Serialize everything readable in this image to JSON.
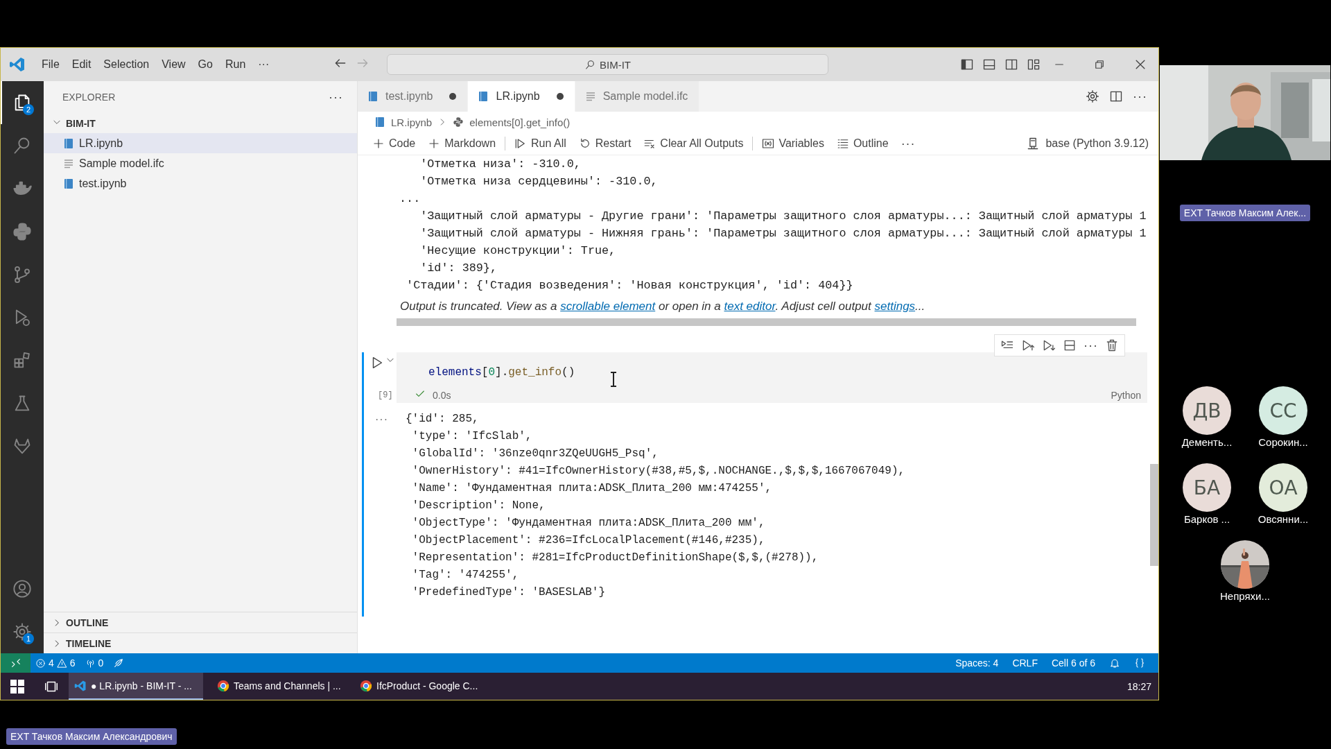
{
  "window": {
    "menu": [
      "File",
      "Edit",
      "Selection",
      "View",
      "Go",
      "Run"
    ],
    "menu_more": "···",
    "command_center": "BIM-IT"
  },
  "activity_bar": {
    "top": [
      {
        "kind": "explorer",
        "selected": true,
        "badge": "2"
      },
      {
        "kind": "search",
        "selected": false
      },
      {
        "kind": "docker",
        "selected": false
      },
      {
        "kind": "python",
        "selected": false
      },
      {
        "kind": "scm",
        "selected": false
      },
      {
        "kind": "debug",
        "selected": false
      },
      {
        "kind": "extensions",
        "selected": false
      },
      {
        "kind": "testing",
        "selected": false
      },
      {
        "kind": "gitlab",
        "selected": false
      }
    ],
    "bottom": [
      {
        "kind": "account",
        "selected": false
      },
      {
        "kind": "settings",
        "selected": false,
        "badge": "1"
      }
    ]
  },
  "sidebar": {
    "title": "EXPLORER",
    "more": "···",
    "folder": {
      "label": "BIM-IT",
      "expanded": true,
      "children": [
        {
          "label": "LR.ipynb",
          "kind": "notebook",
          "selected": true
        },
        {
          "label": "Sample model.ifc",
          "kind": "text",
          "selected": false
        },
        {
          "label": "test.ipynb",
          "kind": "notebook",
          "selected": false
        }
      ]
    },
    "sections": [
      {
        "label": "OUTLINE",
        "expanded": false
      },
      {
        "label": "TIMELINE",
        "expanded": false
      }
    ]
  },
  "tabs": [
    {
      "label": "test.ipynb",
      "kind": "notebook",
      "selected": false,
      "dirty": true
    },
    {
      "label": "LR.ipynb",
      "kind": "notebook",
      "selected": true,
      "dirty": true
    },
    {
      "label": "Sample model.ifc",
      "kind": "text",
      "selected": false,
      "dirty": false
    }
  ],
  "breadcrumb": [
    {
      "label": "LR.ipynb",
      "kind": "notebook"
    },
    {
      "label": "elements[0].get_info()",
      "kind": "python"
    }
  ],
  "toolbar": [
    {
      "kind": "add",
      "label": "Code"
    },
    {
      "kind": "add",
      "label": "Markdown"
    },
    {
      "kind": "separator"
    },
    {
      "kind": "run-all",
      "label": "Run All"
    },
    {
      "kind": "restart",
      "label": "Restart"
    },
    {
      "kind": "clear",
      "label": "Clear All Outputs"
    },
    {
      "kind": "separator"
    },
    {
      "kind": "variables",
      "label": "Variables"
    },
    {
      "kind": "outline",
      "label": "Outline"
    },
    {
      "kind": "more",
      "label": "···"
    }
  ],
  "kernel": "base (Python 3.9.12)",
  "previous_output": [
    "   'Отметка низа': -310.0,",
    "   'Отметка низа сердцевины': -310.0,",
    "...",
    "   'Защитный слой арматуры - Другие грани': 'Параметры защитного слоя арматуры...: Защитный слой арматуры 1",
    "   'Защитный слой арматуры - Нижняя грань': 'Параметры защитного слоя арматуры...: Защитный слой арматуры 1",
    "   'Несущие конструкции': True,",
    "   'id': 389},",
    " 'Стадии': {'Стадия возведения': 'Новая конструкция', 'id': 404}}"
  ],
  "truncation_notice": [
    {
      "kind": "text",
      "text": "Output is truncated. View as a "
    },
    {
      "kind": "link",
      "text": "scrollable element"
    },
    {
      "kind": "text",
      "text": " or open in a "
    },
    {
      "kind": "link",
      "text": "text editor"
    },
    {
      "kind": "text",
      "text": ". Adjust cell output "
    },
    {
      "kind": "link",
      "text": "settings"
    },
    {
      "kind": "text",
      "text": "..."
    }
  ],
  "cell": {
    "focused": true,
    "execution_count": "[9]",
    "succeeded": true,
    "duration": "0.0s",
    "language": "Python",
    "more": "···",
    "code": [
      {
        "text": "elements",
        "kind": "variable"
      },
      {
        "text": "[",
        "kind": "punct"
      },
      {
        "text": "0",
        "kind": "number"
      },
      {
        "text": "].",
        "kind": "punct"
      },
      {
        "text": "get_info",
        "kind": "function"
      },
      {
        "text": "()",
        "kind": "punct"
      }
    ],
    "output_gutter": "···",
    "output": [
      "{'id': 285,",
      " 'type': 'IfcSlab',",
      " 'GlobalId': '36nze0qnr3ZQeUUGH5_Psq',",
      " 'OwnerHistory': #41=IfcOwnerHistory(#38,#5,$,.NOCHANGE.,$,$,$,1667067049),",
      " 'Name': 'Фундаментная плита:ADSK_Плита_200 мм:474255',",
      " 'Description': None,",
      " 'ObjectType': 'Фундаментная плита:ADSK_Плита_200 мм',",
      " 'ObjectPlacement': #236=IfcLocalPlacement(#146,#235),",
      " 'Representation': #281=IfcProductDefinitionShape($,$,(#278)),",
      " 'Tag': '474255',",
      " 'PredefinedType': 'BASESLAB'}"
    ]
  },
  "status_bar": {
    "errors": "4",
    "warnings": "6",
    "ports": "0",
    "right": [
      "Spaces: 4",
      "CRLF",
      "Cell 6 of 6"
    ]
  },
  "taskbar": {
    "items": [
      {
        "kind": "vscode",
        "label": "● LR.ipynb - BIM-IT - ...",
        "selected": true
      },
      {
        "kind": "browser",
        "label": "Teams and Channels | ...",
        "selected": false
      },
      {
        "kind": "browser",
        "label": "IfcProduct - Google C...",
        "selected": false
      }
    ],
    "clock": "18:27"
  },
  "meeting": {
    "presenter": "EXT Тачков Максим Алек...",
    "participants": [
      {
        "kind": "initials",
        "initials": "ДВ",
        "name": "Дементь...",
        "color": "#e9dcd8"
      },
      {
        "kind": "initials",
        "initials": "СС",
        "name": "Сорокин...",
        "color": "#d5ece2"
      },
      {
        "kind": "initials",
        "initials": "БА",
        "name": "Барков ...",
        "color": "#e9dcd8"
      },
      {
        "kind": "initials",
        "initials": "ОА",
        "name": "Овсянни...",
        "color": "#e3ecdb"
      },
      {
        "kind": "picture",
        "name": "Непряхи..."
      }
    ],
    "sharing_label": "EXT Тачков Максим Александрович"
  }
}
